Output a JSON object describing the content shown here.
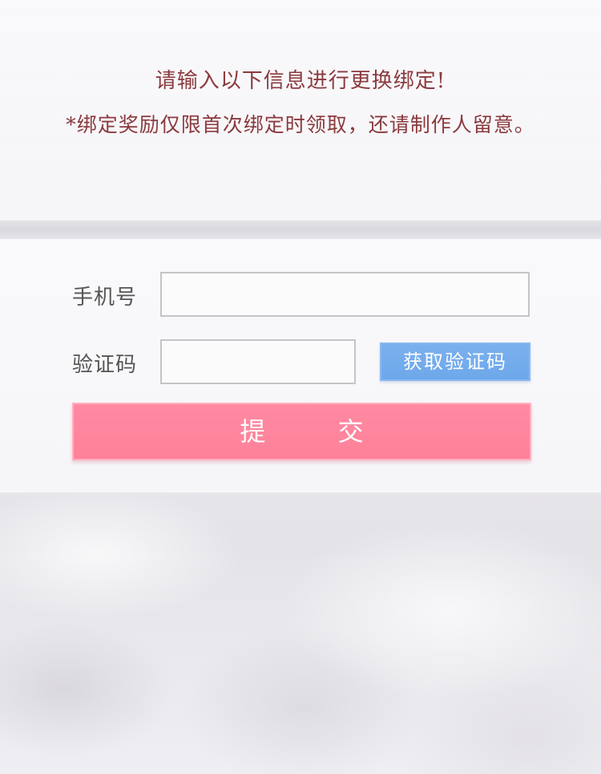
{
  "notice": {
    "line1": "请输入以下信息进行更换绑定!",
    "line2": "*绑定奖励仅限首次绑定时领取，还请制作人留意。"
  },
  "form": {
    "phone_label": "手机号",
    "phone_value": "",
    "code_label": "验证码",
    "code_value": "",
    "get_code_label": "获取验证码",
    "submit_label": "提 交"
  },
  "colors": {
    "notice_text": "#8a3a3e",
    "code_button": "#6ea8ea",
    "submit_button": "#fd8199"
  }
}
